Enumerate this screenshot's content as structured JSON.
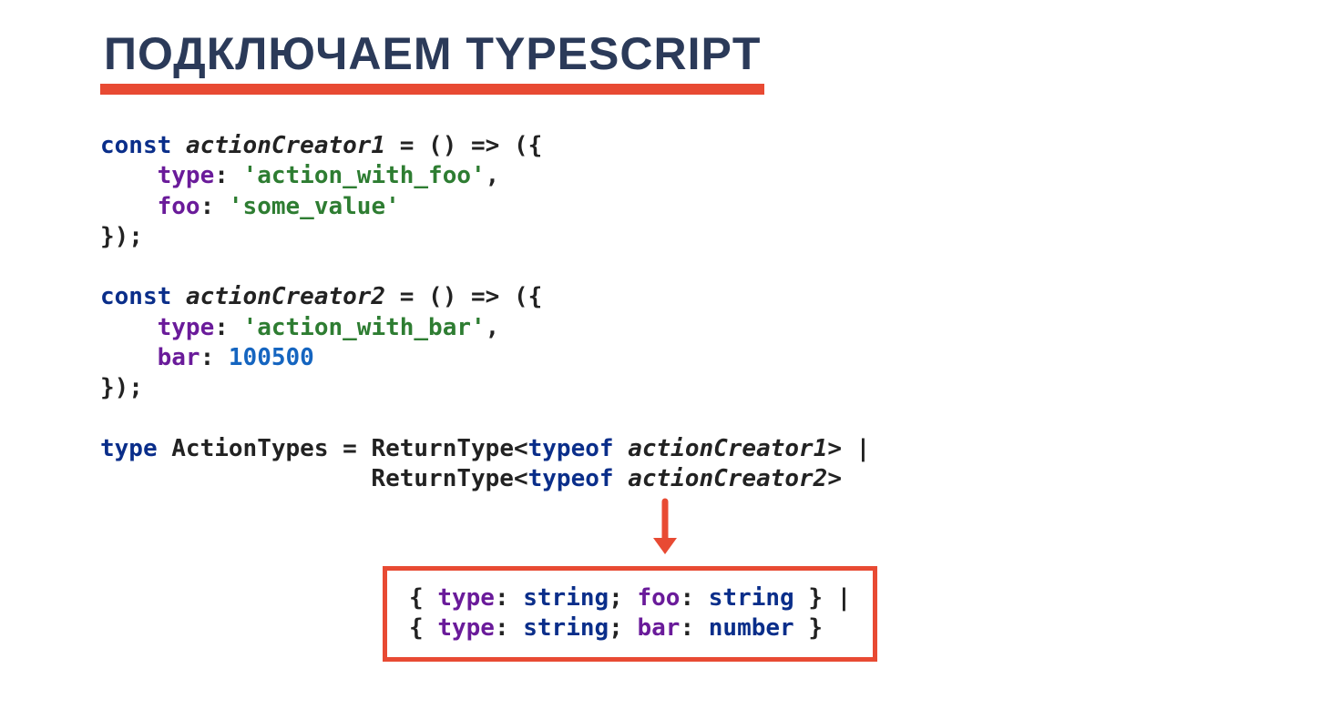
{
  "heading": "ПОДКЛЮЧАЕМ TYPESCRIPT",
  "code": {
    "l1": {
      "const": "const",
      "id": "actionCreator1",
      "rest": " = () => ({"
    },
    "l2": {
      "key": "type",
      "val": "'action_with_foo'"
    },
    "l3": {
      "key": "foo",
      "val": "'some_value'"
    },
    "l4": "});",
    "l5": {
      "const": "const",
      "id": "actionCreator2",
      "rest": " = () => ({"
    },
    "l6": {
      "key": "type",
      "val": "'action_with_bar'"
    },
    "l7": {
      "key": "bar",
      "val": "100500"
    },
    "l8": "});",
    "l9": {
      "type": "type",
      "name": "ActionTypes",
      "eq": " = ",
      "rt": "ReturnType<",
      "typeof": "typeof",
      "tgt": "actionCreator1",
      "close": "> |"
    },
    "l10": {
      "rt": "ReturnType<",
      "typeof": "typeof",
      "tgt": "actionCreator2",
      "close": ">"
    }
  },
  "result": {
    "r1": {
      "open": "{ ",
      "k1": "type",
      "t1": "string",
      "sep1": "; ",
      "k2": "foo",
      "t2": "string",
      "close": " } |"
    },
    "r2": {
      "open": "{ ",
      "k1": "type",
      "t1": "string",
      "sep1": "; ",
      "k2": "bar",
      "t2": "number",
      "close": " }"
    }
  }
}
